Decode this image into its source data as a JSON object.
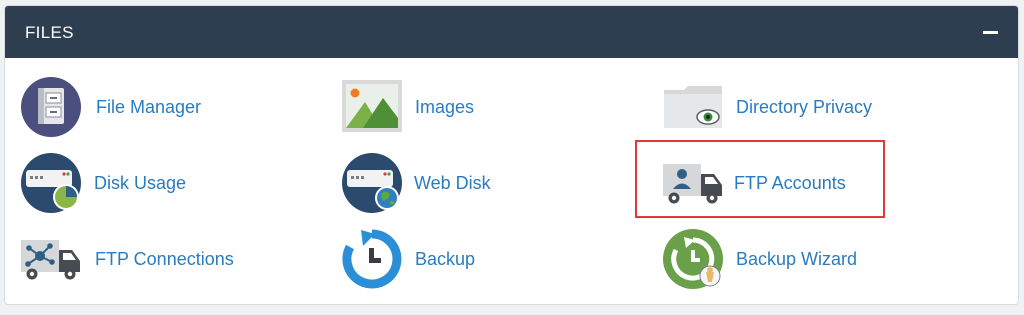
{
  "section": {
    "title": "FILES",
    "collapse_icon": "minus-icon"
  },
  "items": {
    "file_manager": {
      "label": "File Manager",
      "icon": "file-cabinet-icon"
    },
    "images": {
      "label": "Images",
      "icon": "image-icon"
    },
    "directory_privacy": {
      "label": "Directory Privacy",
      "icon": "folder-eye-icon"
    },
    "disk_usage": {
      "label": "Disk Usage",
      "icon": "disk-pie-icon"
    },
    "web_disk": {
      "label": "Web Disk",
      "icon": "disk-globe-icon"
    },
    "ftp_accounts": {
      "label": "FTP Accounts",
      "icon": "truck-user-icon"
    },
    "ftp_connections": {
      "label": "FTP Connections",
      "icon": "truck-network-icon"
    },
    "backup": {
      "label": "Backup",
      "icon": "backup-clock-icon"
    },
    "backup_wizard": {
      "label": "Backup Wizard",
      "icon": "backup-wizard-icon"
    }
  },
  "colors": {
    "header_bg": "#2c3e50",
    "link": "#2a7bbf",
    "highlight": "#e0383e"
  }
}
